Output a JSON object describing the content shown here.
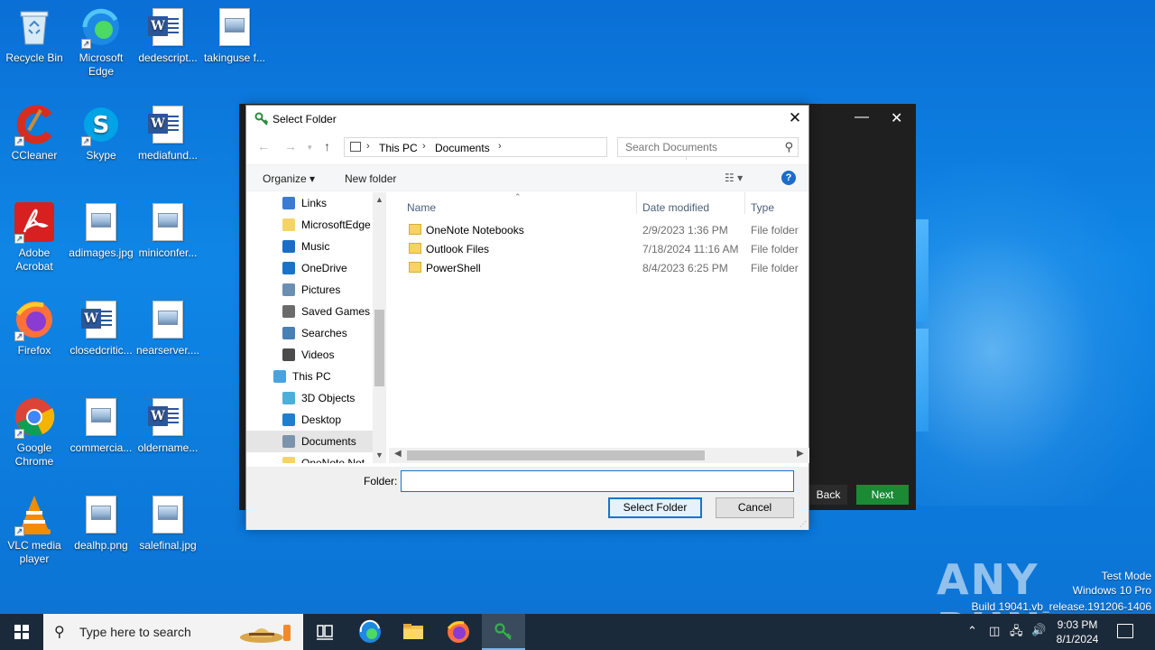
{
  "desktop": {
    "icons": [
      {
        "label": "Recycle Bin",
        "icon": "recycle-bin-icon"
      },
      {
        "label": "Microsoft Edge",
        "icon": "edge-icon"
      },
      {
        "label": "dedescript...",
        "icon": "word-doc-icon"
      },
      {
        "label": "takinguse f...",
        "icon": "image-file-icon"
      },
      {
        "label": "CCleaner",
        "icon": "ccleaner-icon"
      },
      {
        "label": "Skype",
        "icon": "skype-icon"
      },
      {
        "label": "mediafund...",
        "icon": "word-doc-icon"
      },
      {
        "label": "Adobe Acrobat",
        "icon": "acrobat-icon"
      },
      {
        "label": "adimages.jpg",
        "icon": "image-file-icon"
      },
      {
        "label": "miniconfer...",
        "icon": "image-file-icon"
      },
      {
        "label": "Firefox",
        "icon": "firefox-icon"
      },
      {
        "label": "closedcritic...",
        "icon": "word-doc-icon"
      },
      {
        "label": "nearserver....",
        "icon": "image-file-icon"
      },
      {
        "label": "Google Chrome",
        "icon": "chrome-icon"
      },
      {
        "label": "commercia...",
        "icon": "image-file-icon"
      },
      {
        "label": "oldername...",
        "icon": "word-doc-icon"
      },
      {
        "label": "VLC media player",
        "icon": "vlc-icon"
      },
      {
        "label": "dealhp.png",
        "icon": "image-file-icon"
      },
      {
        "label": "salefinal.jpg",
        "icon": "image-file-icon"
      }
    ]
  },
  "background_window": {
    "minimize": "—",
    "close": "✕",
    "back_label": "Back",
    "next_label": "Next",
    "next_color": "#1a8a35"
  },
  "dialog": {
    "title": "Select Folder",
    "close": "✕",
    "breadcrumb": [
      "This PC",
      "Documents"
    ],
    "search_placeholder": "Search Documents",
    "toolbar": {
      "organize": "Organize ▾",
      "new_folder": "New folder",
      "help": "?"
    },
    "nav_items": [
      {
        "label": "Links",
        "icon": "links-icon"
      },
      {
        "label": "MicrosoftEdge",
        "icon": "folder-icon"
      },
      {
        "label": "Music",
        "icon": "music-icon"
      },
      {
        "label": "OneDrive",
        "icon": "onedrive-icon"
      },
      {
        "label": "Pictures",
        "icon": "pictures-icon"
      },
      {
        "label": "Saved Games",
        "icon": "saved-games-icon"
      },
      {
        "label": "Searches",
        "icon": "searches-icon"
      },
      {
        "label": "Videos",
        "icon": "videos-icon"
      },
      {
        "label": "This PC",
        "icon": "this-pc-icon"
      },
      {
        "label": "3D Objects",
        "icon": "3d-objects-icon"
      },
      {
        "label": "Desktop",
        "icon": "desktop-icon"
      },
      {
        "label": "Documents",
        "icon": "documents-icon"
      },
      {
        "label": "OneNote Not",
        "icon": "folder-icon"
      }
    ],
    "columns": {
      "name": "Name",
      "date": "Date modified",
      "type": "Type"
    },
    "files": [
      {
        "name": "OneNote Notebooks",
        "date": "2/9/2023 1:36 PM",
        "type": "File folder"
      },
      {
        "name": "Outlook Files",
        "date": "7/18/2024 11:16 AM",
        "type": "File folder"
      },
      {
        "name": "PowerShell",
        "date": "8/4/2023 6:25 PM",
        "type": "File folder"
      }
    ],
    "folder_label": "Folder:",
    "folder_value": "",
    "select_button": "Select Folder",
    "cancel_button": "Cancel"
  },
  "watermark": {
    "brand": "ANY RUN",
    "line1": "Test Mode",
    "line2": "Windows 10 Pro",
    "line3": "Build 19041.vb_release.191206-1406"
  },
  "taskbar": {
    "search_placeholder": "Type here to search",
    "apps": [
      "task-view-icon",
      "edge-icon",
      "file-explorer-icon",
      "firefox-icon",
      "installer-icon"
    ],
    "time": "9:03 PM",
    "date": "8/1/2024"
  }
}
